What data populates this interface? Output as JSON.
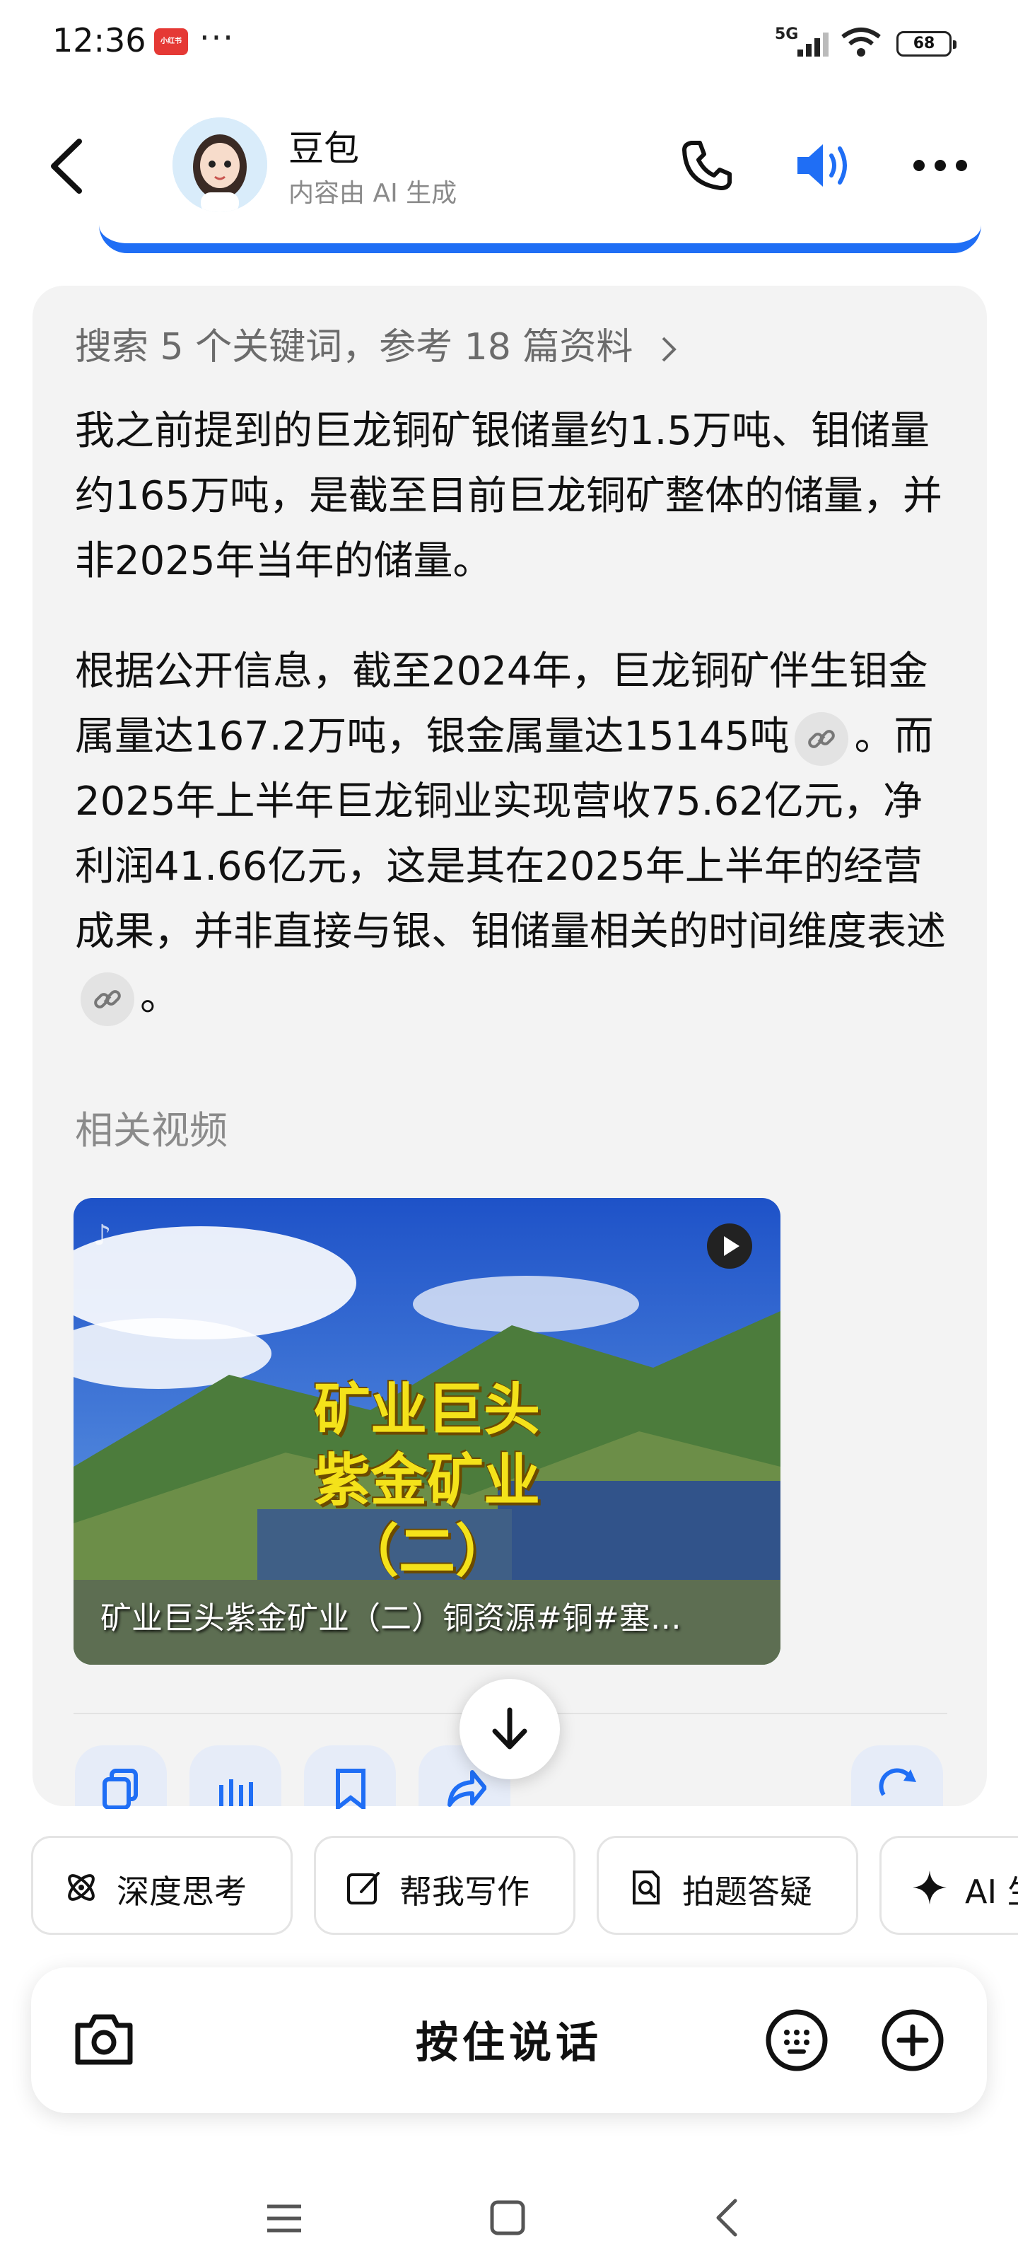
{
  "status_bar": {
    "time": "12:36",
    "app_badge": "小红书",
    "dots": "···",
    "network": "5G",
    "battery": "68"
  },
  "header": {
    "title": "豆包",
    "subtitle": "内容由 AI 生成"
  },
  "message": {
    "search_summary": "搜索 5 个关键词，参考 18 篇资料",
    "paragraph1": "我之前提到的巨龙铜矿银储量约1.5万吨、钼储量约165万吨，是截至目前巨龙铜矿整体的储量，并非2025年当年的储量。",
    "paragraph2_a": "根据公开信息，截至2024年，巨龙铜矿伴生钼金属量达167.2万吨，银金属量达15145吨",
    "paragraph2_b": "。而2025年上半年巨龙铜业实现营收75.62亿元，净利润41.66亿元，这是其在2025年上半年的经营成果，并非直接与银、钼储量相关的时间维度表述",
    "paragraph2_c": "。",
    "related_videos_title": "相关视频",
    "video": {
      "overlay_title_1": "矿业巨头",
      "overlay_title_2": "紫金矿业",
      "overlay_title_3": "（二）",
      "caption": "矿业巨头紫金矿业（二）铜资源#铜#塞…"
    }
  },
  "quick_chips": [
    {
      "label": "深度思考",
      "icon": "atom-icon"
    },
    {
      "label": "帮我写作",
      "icon": "edit-icon"
    },
    {
      "label": "拍题答疑",
      "icon": "doc-search-icon"
    },
    {
      "label": "AI 生",
      "icon": "sparkle-icon"
    }
  ],
  "input_bar": {
    "hold_to_talk": "按住说话"
  },
  "colors": {
    "accent": "#1f6ef5",
    "bubble": "#f3f3f3"
  }
}
